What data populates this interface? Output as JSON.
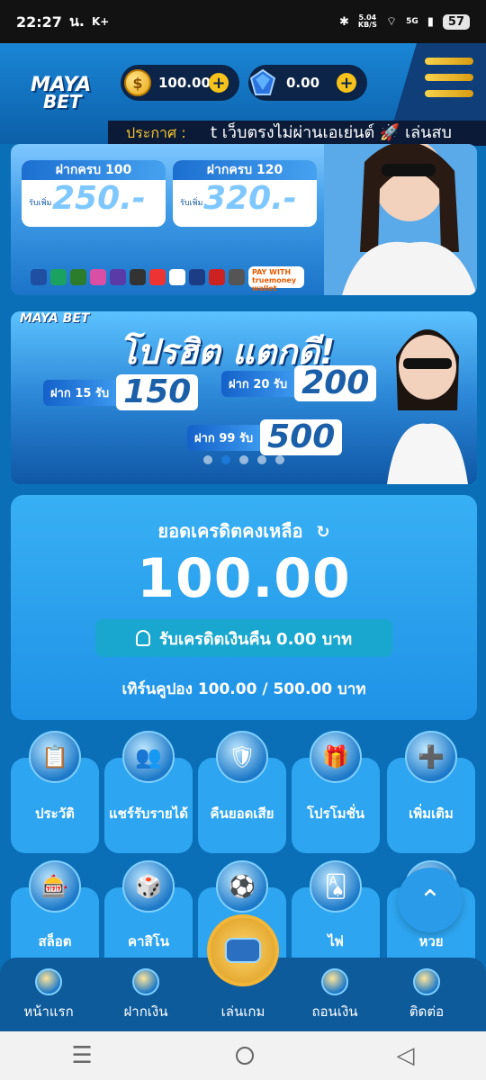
{
  "status_bar": {
    "time": "22:27",
    "carrier": "น.",
    "extra": "K+",
    "speed": "5.04",
    "speed_unit": "KB/S",
    "network": "5G",
    "battery": "57"
  },
  "header": {
    "logo_line1": "MAYA",
    "logo_line2": "BET",
    "coin_balance": "100.00",
    "gem_balance": "0.00",
    "coin_symbol": "$",
    "plus": "+",
    "announce_label": "ประกาศ :",
    "announce_text": "t เว็บตรงไม่ผ่านเอเย่นต์ 🚀 เล่นสบ"
  },
  "banner1": {
    "dep1_title": "ฝากครบ 100",
    "dep1_sub": "รับเพิ่ม",
    "dep1_value": "250.-",
    "dep2_title": "ฝากครบ 120",
    "dep2_sub": "รับเพิ่ม",
    "dep2_value": "320.-",
    "pay_label": "PAY WITH",
    "tm_label": "truemoney wallet"
  },
  "banner2": {
    "logo": "MAYA BET",
    "headline": "โปรฮิต แตกดี!",
    "b1_key": "ฝาก 15 รับ",
    "b1_val": "150",
    "b2_key": "ฝาก 20 รับ",
    "b2_val": "200",
    "b3_key": "ฝาก 99 รับ",
    "b3_val": "500",
    "carousel_total": 5,
    "carousel_active": 2
  },
  "balance": {
    "title": "ยอดเครดิตคงเหลือ",
    "refresh_icon": "↻",
    "amount": "100.00",
    "cashback": "รับเครดิตเงินคืน  0.00  บาท",
    "turnover": "เทิร์นคูปอง 100.00 / 500.00 บาท"
  },
  "grid_row1": [
    {
      "label": "ประวัติ",
      "icon": "📋"
    },
    {
      "label": "แชร์รับรายได้",
      "icon": "👥"
    },
    {
      "label": "คืนยอดเสีย",
      "icon": "🛡"
    },
    {
      "label": "โปรโมชั่น",
      "icon": "🎁"
    },
    {
      "label": "เพิ่มเติม",
      "icon": "➕"
    }
  ],
  "grid_row2": [
    {
      "label": "สล็อต",
      "icon": "🎰"
    },
    {
      "label": "คาสิโน",
      "icon": "🎲"
    },
    {
      "label": "",
      "icon": "⚽"
    },
    {
      "label": "ไพ่",
      "icon": "🂡"
    },
    {
      "label": "หวย",
      "icon": "🎱"
    }
  ],
  "bottom_nav": [
    {
      "label": "หน้าแรก"
    },
    {
      "label": "ฝากเงิน"
    },
    {
      "label": "เล่นเกม"
    },
    {
      "label": "ถอนเงิน"
    },
    {
      "label": "ติดต่อ"
    }
  ],
  "scroll_top_icon": "⌃",
  "system_nav": {
    "recents": "☰",
    "back": "◁"
  }
}
